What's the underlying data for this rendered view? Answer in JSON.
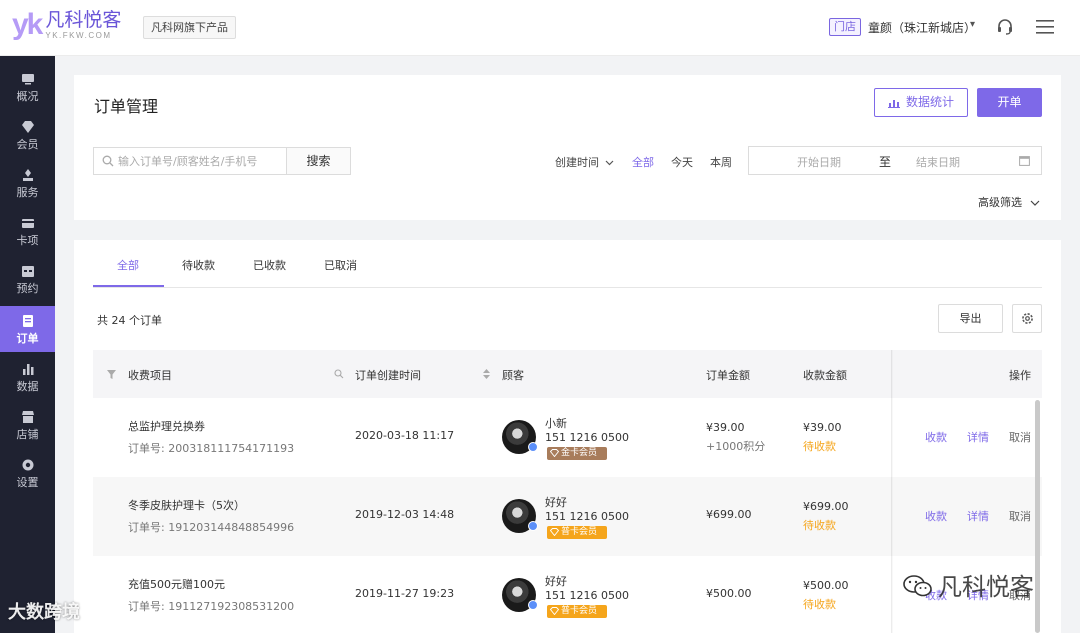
{
  "header": {
    "logo_mark": "yk",
    "logo_name": "凡科悦客",
    "logo_sub": "YK.FKW.COM",
    "product_tag": "凡科网旗下产品",
    "store_tag": "门店",
    "store_name": "童颜（珠江新城店）",
    "store_caret": "▾"
  },
  "sidebar": {
    "items": [
      {
        "label": "概况",
        "icon": "monitor-icon"
      },
      {
        "label": "会员",
        "icon": "diamond-icon"
      },
      {
        "label": "服务",
        "icon": "service-icon"
      },
      {
        "label": "卡项",
        "icon": "card-icon"
      },
      {
        "label": "预约",
        "icon": "calendar-icon"
      },
      {
        "label": "订单",
        "icon": "order-icon",
        "active": true
      },
      {
        "label": "数据",
        "icon": "chart-icon"
      },
      {
        "label": "店铺",
        "icon": "store-icon"
      },
      {
        "label": "设置",
        "icon": "gear-icon"
      }
    ]
  },
  "main": {
    "title": "订单管理",
    "stats_button": "数据统计",
    "open_button": "开单",
    "search_placeholder": "输入订单号/顾客姓名/手机号",
    "search_button": "搜索",
    "filter_label": "创建时间",
    "filter_options": [
      "全部",
      "今天",
      "本周"
    ],
    "date_start": "开始日期",
    "date_to": "至",
    "date_end": "结束日期",
    "advanced_filter": "高级筛选"
  },
  "orders": {
    "tabs": [
      "全部",
      "待收款",
      "已收款",
      "已取消"
    ],
    "total_text": "共 24 个订单",
    "export_button": "导出",
    "columns": [
      "收费项目",
      "订单创建时间",
      "顾客",
      "订单金额",
      "收款金额",
      "操作"
    ],
    "rows": [
      {
        "item": "总监护理兑换券",
        "order_no": "订单号: 2003181117541711​93",
        "time": "2020-03-18 11:17",
        "customer": "小新",
        "phone": "151 1216 0500",
        "member": "金卡会员",
        "amount": "¥39.00",
        "amount_extra": "+1000积分",
        "paid": "¥39.00",
        "status": "待收款",
        "actions": [
          "收款",
          "详情",
          "取消"
        ]
      },
      {
        "item": "冬季皮肤护理卡（5次）",
        "order_no": "订单号: 191203144848854996",
        "time": "2019-12-03 14:48",
        "customer": "好好",
        "phone": "151 1216 0500",
        "member": "普卡会员",
        "amount": "¥699.00",
        "amount_extra": "",
        "paid": "¥699.00",
        "status": "待收款",
        "actions": [
          "收款",
          "详情",
          "取消"
        ]
      },
      {
        "item": "充值500元赠100元",
        "order_no": "订单号: 191127192308531200",
        "time": "2019-11-27 19:23",
        "customer": "好好",
        "phone": "151 1216 0500",
        "member": "普卡会员",
        "amount": "¥500.00",
        "amount_extra": "",
        "paid": "¥500.00",
        "status": "待收款",
        "actions": [
          "收款",
          "详情",
          "取消"
        ]
      }
    ]
  },
  "watermarks": {
    "left": "大数跨境",
    "right": "凡科悦客"
  },
  "colors": {
    "accent": "#7e69e8",
    "sidebar_bg": "#1f2231",
    "pending": "#f5a51b",
    "gold_member": "#a87c5b"
  }
}
